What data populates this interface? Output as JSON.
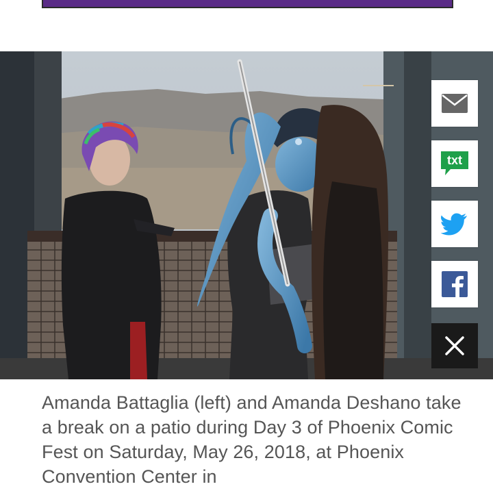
{
  "ad": {
    "color": "#5a2b87"
  },
  "photo": {
    "alt": ""
  },
  "share": {
    "email_icon": "envelope-icon",
    "txt_label": "txt",
    "txt_color": "#1fa04a",
    "twitter_icon": "twitter-bird-icon",
    "twitter_color": "#1da1f2",
    "facebook_icon": "facebook-f-icon",
    "facebook_color": "#3b5998",
    "close_icon": "close-x-icon"
  },
  "caption": {
    "text": "Amanda Battaglia (left) and Amanda Deshano take a break on a patio during Day 3 of Phoenix Comic Fest on Saturday, May 26, 2018, at Phoenix Convention Center in"
  }
}
